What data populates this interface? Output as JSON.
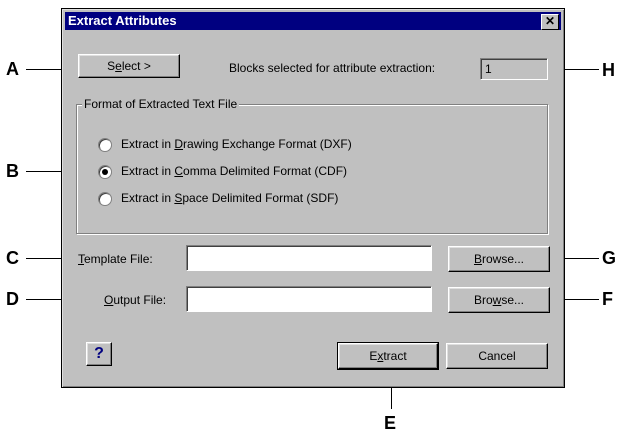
{
  "dialog": {
    "title": "Extract Attributes",
    "close_label": "✕"
  },
  "select_button": {
    "pre": "S",
    "accel": "e",
    "post": "lect >"
  },
  "blocks_label": "Blocks selected for attribute extraction:",
  "blocks_value": "1",
  "format_group": {
    "label": "Format of Extracted Text File",
    "options": [
      {
        "pre": "Extract in ",
        "accel": "D",
        "post": "rawing Exchange Format (DXF)",
        "selected": false
      },
      {
        "pre": "Extract in ",
        "accel": "C",
        "post": "omma Delimited Format (CDF)",
        "selected": true
      },
      {
        "pre": "Extract in ",
        "accel": "S",
        "post": "pace Delimited Format (SDF)",
        "selected": false
      }
    ]
  },
  "template": {
    "accel": "T",
    "post": "emplate File:",
    "value": ""
  },
  "output": {
    "accel": "O",
    "post": "utput File:",
    "value": ""
  },
  "browse1": {
    "pre": "",
    "accel": "B",
    "post": "rowse..."
  },
  "browse2": {
    "pre": "Bro",
    "accel": "w",
    "post": "se..."
  },
  "extract_button": {
    "pre": "E",
    "accel": "x",
    "post": "tract"
  },
  "cancel_label": "Cancel",
  "help_label": "?",
  "callouts": {
    "A": "A",
    "B": "B",
    "C": "C",
    "D": "D",
    "E": "E",
    "F": "F",
    "G": "G",
    "H": "H"
  }
}
